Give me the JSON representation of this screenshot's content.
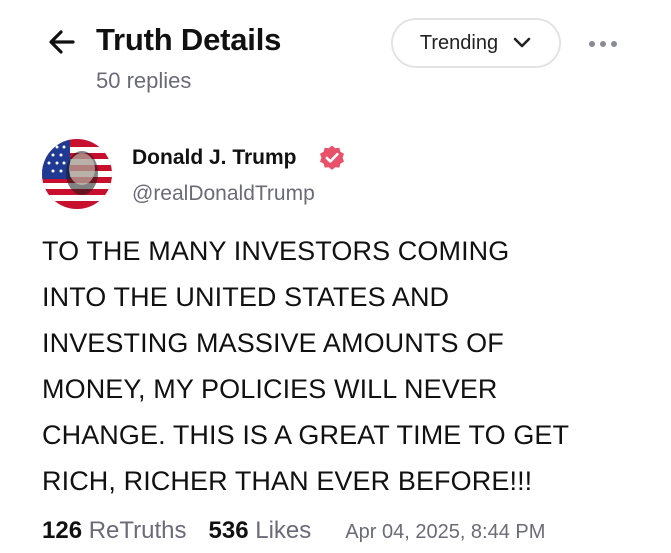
{
  "header": {
    "title": "Truth Details",
    "subtitle": "50 replies",
    "sort_label": "Trending",
    "icons": {
      "back": "arrow-left-icon",
      "sort": "chevron-down-icon",
      "more": "more-horizontal-icon"
    }
  },
  "post": {
    "author_name": "Donald J. Trump",
    "author_handle": "@realDonaldTrump",
    "verified": true,
    "body": "TO THE MANY INVESTORS COMING\nINTO THE UNITED STATES AND\nINVESTING MASSIVE AMOUNTS OF\nMONEY, MY POLICIES WILL NEVER\nCHANGE. THIS IS A GREAT TIME TO GET\nRICH, RICHER THAN EVER BEFORE!!!",
    "retruths_count": "126",
    "retruths_label": "ReTruths",
    "likes_count": "536",
    "likes_label": "Likes",
    "timestamp": "Apr 04, 2025, 8:44 PM"
  },
  "colors": {
    "text": "#111111",
    "muted": "#6b6b78",
    "border": "#e3e3e6",
    "verified": "#e9516b",
    "avatar_red": "#c8102e",
    "avatar_blue": "#1f3a93"
  }
}
